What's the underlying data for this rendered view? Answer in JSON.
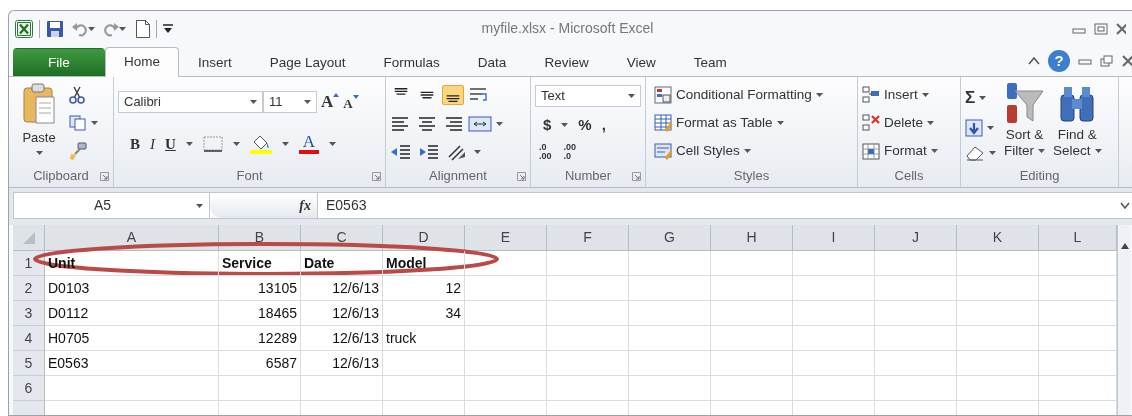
{
  "window": {
    "title": "myfile.xlsx - Microsoft Excel"
  },
  "tabs": [
    {
      "label": "File",
      "kind": "file",
      "selected": false
    },
    {
      "label": "Home",
      "kind": "tab",
      "selected": true
    },
    {
      "label": "Insert",
      "kind": "tab",
      "selected": false
    },
    {
      "label": "Page Layout",
      "kind": "tab",
      "selected": false
    },
    {
      "label": "Formulas",
      "kind": "tab",
      "selected": false
    },
    {
      "label": "Data",
      "kind": "tab",
      "selected": false
    },
    {
      "label": "Review",
      "kind": "tab",
      "selected": false
    },
    {
      "label": "View",
      "kind": "tab",
      "selected": false
    },
    {
      "label": "Team",
      "kind": "tab",
      "selected": false
    }
  ],
  "help": "?",
  "ribbon": {
    "clipboard": {
      "paste": "Paste",
      "label": "Clipboard"
    },
    "font": {
      "name": "Calibri",
      "size": "11",
      "grow": "A",
      "shrink": "A",
      "styles": [
        "B",
        "I",
        "U"
      ],
      "color_button": "A",
      "label": "Font"
    },
    "alignment": {
      "vertical": [
        {
          "selected": false
        },
        {
          "selected": false
        },
        {
          "selected": true
        }
      ],
      "label": "Alignment"
    },
    "number": {
      "format": "Text",
      "symbols": [
        "$",
        "%",
        ","
      ],
      "decimals": [
        {
          "top": ".0",
          "bottom": ".00"
        },
        {
          "top": ".00",
          "bottom": ".0"
        }
      ],
      "label": "Number"
    },
    "styles": {
      "items": [
        "Conditional Formatting",
        "Format as Table",
        "Cell Styles"
      ],
      "label": "Styles"
    },
    "cells": {
      "items": [
        "Insert",
        "Delete",
        "Format"
      ],
      "label": "Cells"
    },
    "editing": {
      "sum": "Σ",
      "sort": [
        "Sort &",
        "Filter"
      ],
      "find": [
        "Find &",
        "Select"
      ],
      "label": "Editing"
    }
  },
  "formula_bar": {
    "name_box": "A5",
    "fx": "fx",
    "value": "E0563"
  },
  "sheet": {
    "columns": [
      "A",
      "B",
      "C",
      "D",
      "E",
      "F",
      "G",
      "H",
      "I",
      "J",
      "K",
      "L"
    ],
    "rows": [
      {
        "label": "1",
        "bold": true,
        "cells": [
          {
            "text": "Unit",
            "kind": "text"
          },
          {
            "text": "Service",
            "kind": "text"
          },
          {
            "text": "Date",
            "kind": "text"
          },
          {
            "text": "Model",
            "kind": "text"
          }
        ]
      },
      {
        "label": "2",
        "bold": false,
        "cells": [
          {
            "text": "D0103",
            "kind": "text"
          },
          {
            "text": "13105",
            "kind": "number"
          },
          {
            "text": "12/6/13",
            "kind": "number"
          },
          {
            "text": "12",
            "kind": "number"
          }
        ]
      },
      {
        "label": "3",
        "bold": false,
        "cells": [
          {
            "text": "D0112",
            "kind": "text"
          },
          {
            "text": "18465",
            "kind": "number"
          },
          {
            "text": "12/6/13",
            "kind": "number"
          },
          {
            "text": "34",
            "kind": "number"
          }
        ]
      },
      {
        "label": "4",
        "bold": false,
        "cells": [
          {
            "text": "H0705",
            "kind": "text"
          },
          {
            "text": "12289",
            "kind": "number"
          },
          {
            "text": "12/6/13",
            "kind": "number"
          },
          {
            "text": "truck",
            "kind": "text"
          }
        ]
      },
      {
        "label": "5",
        "bold": false,
        "cells": [
          {
            "text": "E0563",
            "kind": "text"
          },
          {
            "text": "6587",
            "kind": "number"
          },
          {
            "text": "12/6/13",
            "kind": "number"
          }
        ]
      },
      {
        "label": "6"
      }
    ]
  }
}
